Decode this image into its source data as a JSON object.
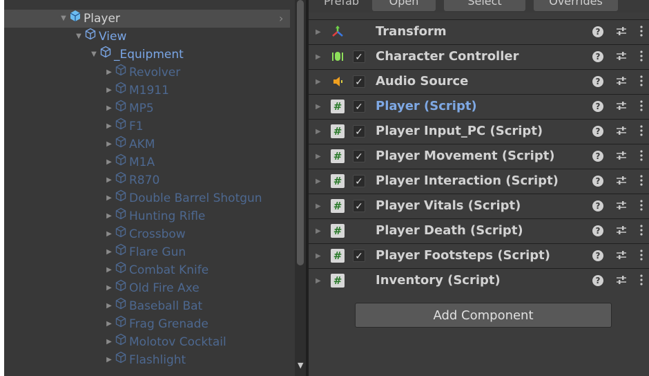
{
  "hierarchy": {
    "rows": [
      {
        "label": "Player",
        "color": "#d4d4d4",
        "indent": 0,
        "arrow": "▼",
        "selected": true
      },
      {
        "label": "View",
        "color": "#7aa6e6",
        "indent": 1,
        "arrow": "▼"
      },
      {
        "label": "_Equipment",
        "color": "#7aa6e6",
        "indent": 2,
        "arrow": "▼"
      },
      {
        "label": "Revolver",
        "color": "#4d6890",
        "indent": 3,
        "arrow": "▶"
      },
      {
        "label": "M1911",
        "color": "#4d6890",
        "indent": 3,
        "arrow": "▶"
      },
      {
        "label": "MP5",
        "color": "#4d6890",
        "indent": 3,
        "arrow": "▶"
      },
      {
        "label": "F1",
        "color": "#4d6890",
        "indent": 3,
        "arrow": "▶"
      },
      {
        "label": "AKM",
        "color": "#4d6890",
        "indent": 3,
        "arrow": "▶"
      },
      {
        "label": "M1A",
        "color": "#4d6890",
        "indent": 3,
        "arrow": "▶"
      },
      {
        "label": "R870",
        "color": "#4d6890",
        "indent": 3,
        "arrow": "▶"
      },
      {
        "label": "Double Barrel Shotgun",
        "color": "#4d6890",
        "indent": 3,
        "arrow": "▶"
      },
      {
        "label": "Hunting Rifle",
        "color": "#4d6890",
        "indent": 3,
        "arrow": "▶"
      },
      {
        "label": "Crossbow",
        "color": "#4d6890",
        "indent": 3,
        "arrow": "▶"
      },
      {
        "label": "Flare Gun",
        "color": "#4d6890",
        "indent": 3,
        "arrow": "▶"
      },
      {
        "label": "Combat Knife",
        "color": "#4d6890",
        "indent": 3,
        "arrow": "▶"
      },
      {
        "label": "Old Fire Axe",
        "color": "#4d6890",
        "indent": 3,
        "arrow": "▶"
      },
      {
        "label": "Baseball Bat",
        "color": "#4d6890",
        "indent": 3,
        "arrow": "▶"
      },
      {
        "label": "Frag Grenade",
        "color": "#4d6890",
        "indent": 3,
        "arrow": "▶"
      },
      {
        "label": "Molotov Cocktail",
        "color": "#4d6890",
        "indent": 3,
        "arrow": "▶"
      },
      {
        "label": "Flashlight",
        "color": "#4d6890",
        "indent": 3,
        "arrow": "▶"
      }
    ]
  },
  "inspector": {
    "prefab_label": "Prefab",
    "prefab_buttons": [
      "Open",
      "Select",
      "Overrides"
    ],
    "components": [
      {
        "name": "Transform",
        "icon": "transform-icon",
        "checkbox": false,
        "highlight": false
      },
      {
        "name": "Character Controller",
        "icon": "character-controller-icon",
        "checkbox": true,
        "highlight": false
      },
      {
        "name": "Audio Source",
        "icon": "audio-source-icon",
        "checkbox": true,
        "highlight": false
      },
      {
        "name": "Player (Script)",
        "icon": "script-icon",
        "checkbox": true,
        "highlight": true
      },
      {
        "name": "Player Input_PC (Script)",
        "icon": "script-icon",
        "checkbox": true,
        "highlight": false
      },
      {
        "name": "Player Movement (Script)",
        "icon": "script-icon",
        "checkbox": true,
        "highlight": false
      },
      {
        "name": "Player Interaction (Script)",
        "icon": "script-icon",
        "checkbox": true,
        "highlight": false
      },
      {
        "name": "Player Vitals (Script)",
        "icon": "script-icon",
        "checkbox": true,
        "highlight": false
      },
      {
        "name": "Player Death (Script)",
        "icon": "script-icon",
        "checkbox": false,
        "highlight": false
      },
      {
        "name": "Player Footsteps (Script)",
        "icon": "script-icon",
        "checkbox": true,
        "highlight": false
      },
      {
        "name": "Inventory (Script)",
        "icon": "script-icon",
        "checkbox": false,
        "highlight": false
      }
    ],
    "add_component_label": "Add Component",
    "checkmark": "✓",
    "help_glyph": "?",
    "hash_glyph": "#"
  }
}
